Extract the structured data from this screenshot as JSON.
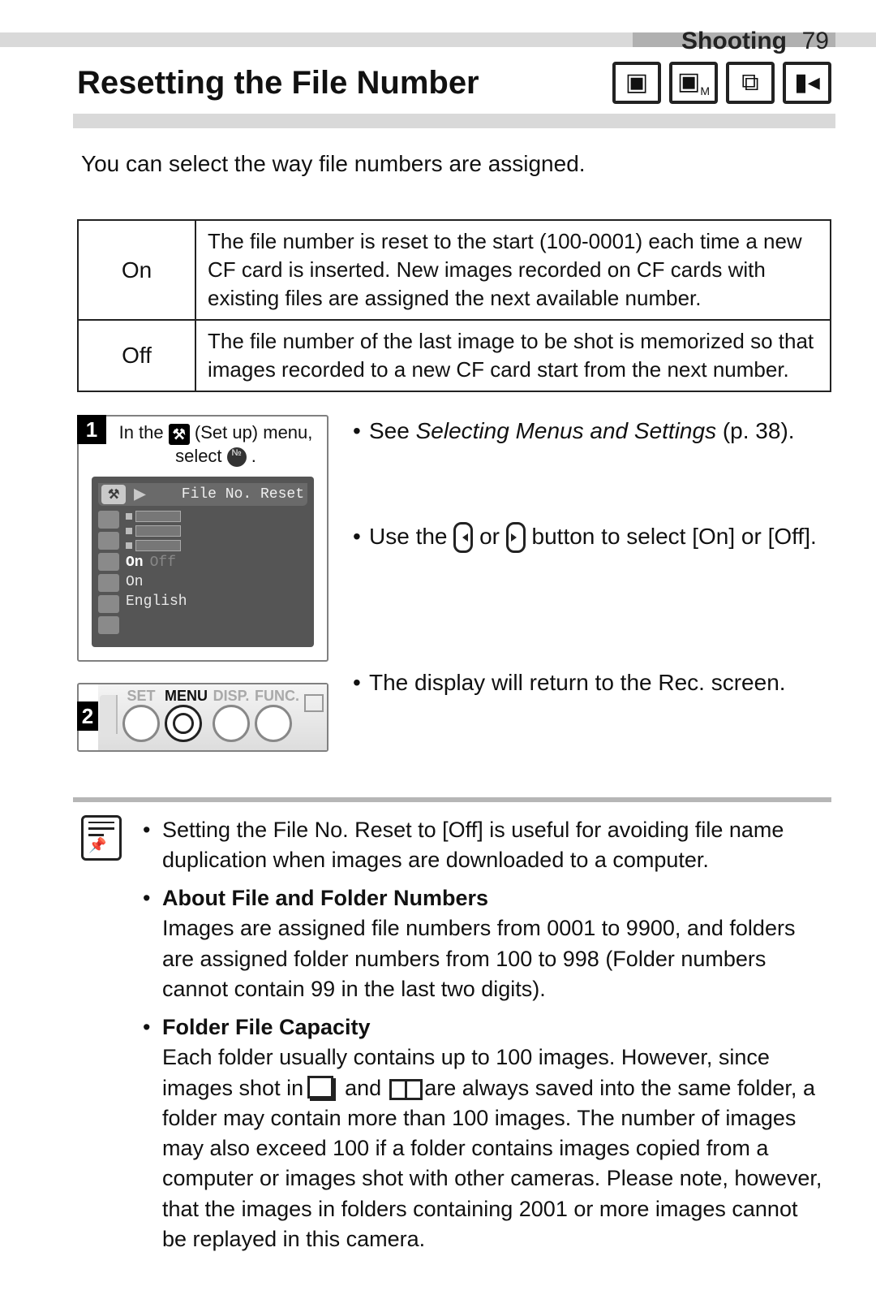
{
  "header": {
    "section": "Shooting",
    "page": "79"
  },
  "title": "Resetting the File Number",
  "intro": "You can select the way file numbers are assigned.",
  "table": {
    "rows": [
      {
        "key": "On",
        "desc": "The file number is reset to the start (100-0001) each time a new CF card is inserted. New images recorded on CF cards with existing files are assigned the next available number."
      },
      {
        "key": "Off",
        "desc": "The file number of the last image to be shot is memorized so that images recorded to a new CF card start from the next number."
      }
    ]
  },
  "steps": {
    "step1": {
      "num": "1",
      "line_pre": "In the ",
      "setup": " (Set up) menu,",
      "line2_pre": "select ",
      "line2_post": ".",
      "lcd": {
        "tab_tools": "⚒",
        "tab_play": "▶",
        "label": "File No. Reset",
        "rows": {
          "r4_on": "On",
          "r4_off": "Off",
          "r5": "On",
          "r6": "English"
        }
      }
    },
    "step2": {
      "num": "2",
      "labels": {
        "set": "SET",
        "menu": "MENU",
        "disp": "DISP.",
        "func": "FUNC."
      }
    }
  },
  "desc": {
    "b1_pre": "See ",
    "b1_ref": "Selecting Menus and Settings",
    "b1_post": " (p. 38).",
    "b2_pre": "Use the ",
    "b2_mid": " or ",
    "b2_post": " button to select [On] or [Off].",
    "b3": "The display will return to the Rec. screen."
  },
  "note": {
    "n1": "Setting the File No. Reset to [Off] is useful for avoiding file name duplication when images are downloaded to a computer.",
    "n2_h": "About File and Folder Numbers",
    "n2_b": "Images are assigned file numbers from 0001 to 9900, and folders are assigned folder numbers from 100 to 998 (Folder numbers cannot contain 99 in the last two digits).",
    "n3_h": "Folder File Capacity",
    "n3_b_pre": "Each folder usually contains up to 100 images. However, since images shot in ",
    "n3_b_mid": " and ",
    "n3_b_post": " are always saved into the same folder, a folder may contain more than 100 images. The number of images may also exceed 100 if a folder contains images copied from a computer or images shot with other cameras. Please note, however, that the images in folders containing 2001 or more images cannot be replayed in this camera."
  },
  "modes": [
    "camera-auto",
    "camera-manual",
    "stitch",
    "movie"
  ]
}
